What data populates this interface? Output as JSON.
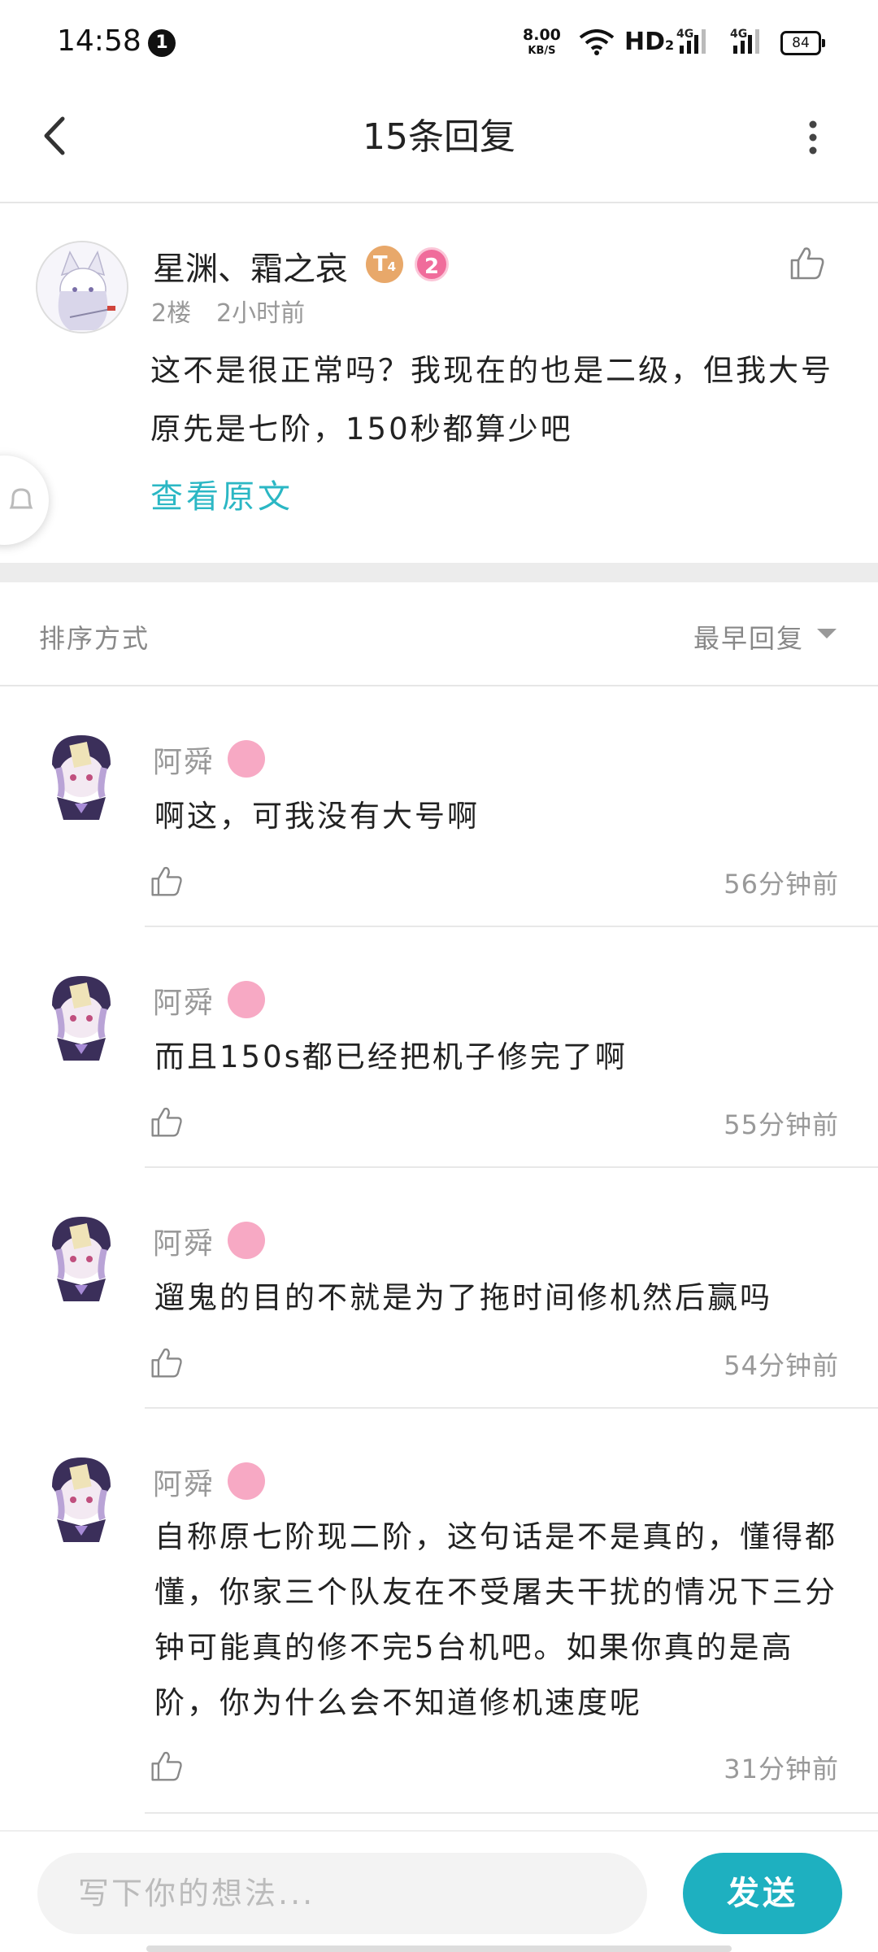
{
  "status_bar": {
    "time": "14:58",
    "notification_count": "1",
    "net_speed": "8.00",
    "net_speed_unit": "KB/S",
    "network_label": "HD",
    "network_sub": "2",
    "sim_label": "4G",
    "battery": "84"
  },
  "header": {
    "title": "15条回复"
  },
  "main_comment": {
    "username": "星渊、霜之哀",
    "badge_level": "T",
    "badge_sub": "4",
    "badge_rank": "2",
    "floor": "2楼",
    "time": "2小时前",
    "text": "这不是很正常吗？我现在的也是二级，但我大号原先是七阶，150秒都算少吧",
    "view_original": "查看原文"
  },
  "sort": {
    "label": "排序方式",
    "value": "最早回复"
  },
  "replies": [
    {
      "username": "阿舜",
      "text": "啊这，可我没有大号啊",
      "time": "56分钟前"
    },
    {
      "username": "阿舜",
      "text": "而且150s都已经把机子修完了啊",
      "time": "55分钟前"
    },
    {
      "username": "阿舜",
      "text": "遛鬼的目的不就是为了拖时间修机然后赢吗",
      "time": "54分钟前"
    },
    {
      "username": "阿舜",
      "text": "自称原七阶现二阶，这句话是不是真的，懂得都懂，你家三个队友在不受屠夫干扰的情况下三分钟可能真的修不完5台机吧。如果你真的是高阶，你为什么会不知道修机速度呢",
      "time": "31分钟前"
    }
  ],
  "composer": {
    "placeholder": "写下你的想法...",
    "send_label": "发送"
  },
  "colors": {
    "accent": "#1eb0c0",
    "link": "#2bb7c4",
    "badge_pink": "#f06c9b"
  }
}
